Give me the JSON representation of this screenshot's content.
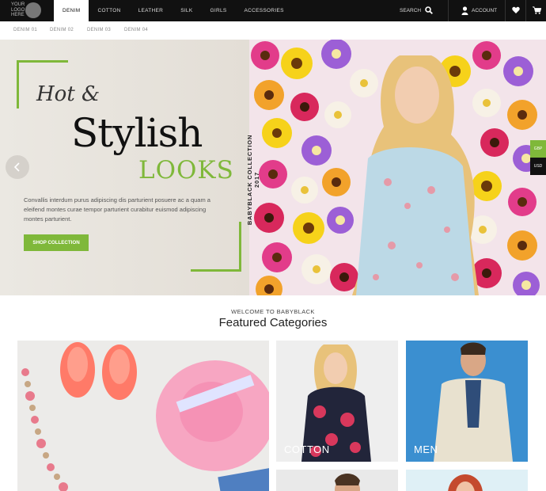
{
  "header": {
    "logo_text": "YOUR LOGO HERE",
    "nav": [
      "DENIM",
      "COTTON",
      "LEATHER",
      "SILK",
      "GIRLS",
      "ACCESSORIES"
    ],
    "search_label": "SEARCH",
    "account_label": "ACCOUNT"
  },
  "subnav": [
    "DENIM 01",
    "DENIM 02",
    "DENIM 03",
    "DENIM 04"
  ],
  "hero": {
    "line1": "Hot &",
    "line2": "Stylish",
    "line3": "LOOKS",
    "description": "Convallis interdum purus adipiscing dis parturient posuere ac a quam a eleifend montes curae tempor parturient curabitur euismod adipiscing montes parturient.",
    "button": "SHOP COLLECTION",
    "collection_text": "BABYBLACK COLLECTION 2017"
  },
  "currency": [
    "GBP",
    "USD"
  ],
  "section": {
    "welcome": "WELCOME TO BABYBLACK",
    "title": "Featured Categories"
  },
  "categories": [
    {
      "label": "COTTON"
    },
    {
      "label": "MEN"
    }
  ],
  "colors": {
    "accent": "#7fb83a",
    "topbar": "#111111"
  }
}
